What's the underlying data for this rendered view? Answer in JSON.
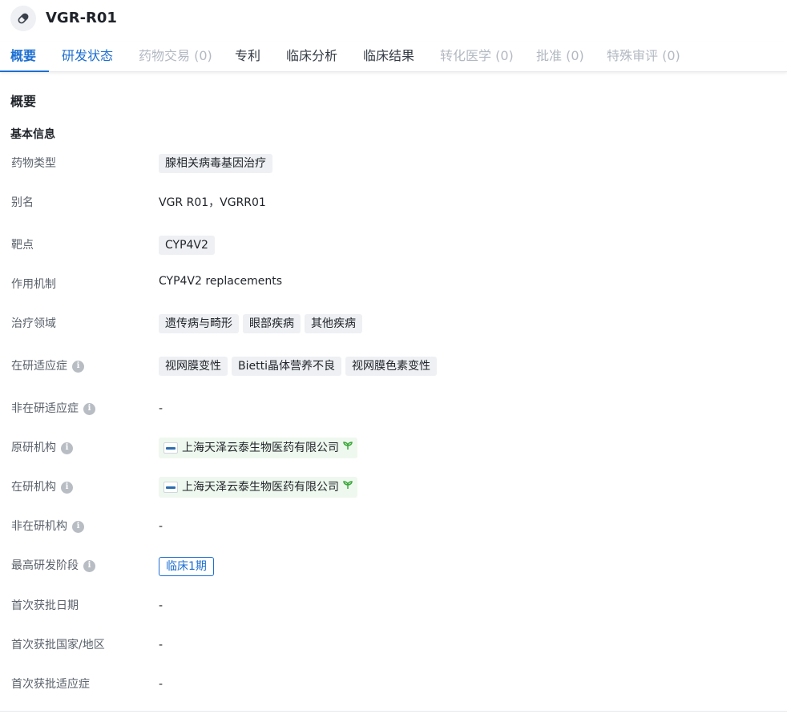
{
  "header": {
    "title": "VGR-R01",
    "icon": "pill-icon"
  },
  "tabs": [
    {
      "label": "概要",
      "state": "active"
    },
    {
      "label": "研发状态",
      "state": "link"
    },
    {
      "label": "药物交易 (0)",
      "state": "disabled"
    },
    {
      "label": "专利",
      "state": "normal"
    },
    {
      "label": "临床分析",
      "state": "normal"
    },
    {
      "label": "临床结果",
      "state": "normal"
    },
    {
      "label": "转化医学 (0)",
      "state": "disabled"
    },
    {
      "label": "批准 (0)",
      "state": "disabled"
    },
    {
      "label": "特殊审评 (0)",
      "state": "disabled"
    }
  ],
  "overview": {
    "title": "概要",
    "basic_info_title": "基本信息"
  },
  "fields": {
    "drug_type": {
      "label": "药物类型",
      "chips": [
        "腺相关病毒基因治疗"
      ]
    },
    "alias": {
      "label": "别名",
      "value": "VGR R01，VGRR01"
    },
    "target": {
      "label": "靶点",
      "chips": [
        "CYP4V2"
      ]
    },
    "mechanism": {
      "label": "作用机制",
      "value": "CYP4V2 replacements"
    },
    "therapeutic_area": {
      "label": "治疗领域",
      "chips": [
        "遗传病与畸形",
        "眼部疾病",
        "其他疾病"
      ]
    },
    "active_indication": {
      "label": "在研适应症",
      "chips": [
        "视网膜变性",
        "Bietti晶体营养不良",
        "视网膜色素变性"
      ]
    },
    "inactive_indication": {
      "label": "非在研适应症",
      "value": "-"
    },
    "originator": {
      "label": "原研机构",
      "org": "上海天泽云泰生物医药有限公司"
    },
    "active_org": {
      "label": "在研机构",
      "org": "上海天泽云泰生物医药有限公司"
    },
    "inactive_org": {
      "label": "非在研机构",
      "value": "-"
    },
    "highest_phase": {
      "label": "最高研发阶段",
      "value": "临床1期"
    },
    "first_approval_date": {
      "label": "首次获批日期",
      "value": "-"
    },
    "first_approval_country": {
      "label": "首次获批国家/地区",
      "value": "-"
    },
    "first_approval_indication": {
      "label": "首次获批适应症",
      "value": "-"
    }
  },
  "colors": {
    "accent": "#1d6fd1",
    "chip_bg": "#eef0f3",
    "org_chip_bg": "#eff8ee",
    "muted": "#b3b9c2"
  },
  "icons": {
    "info": "info-icon",
    "org_logo": "company-logo-icon",
    "sprout": "sprout-icon"
  }
}
